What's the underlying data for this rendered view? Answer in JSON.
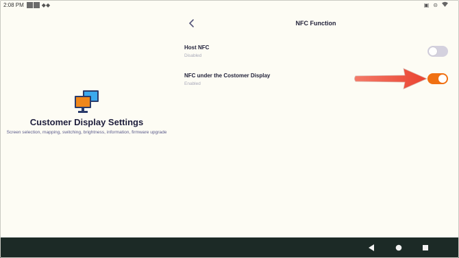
{
  "status_bar": {
    "time": "2:08 PM",
    "notification_icons": [
      "square-icon",
      "square-icon",
      "diamond-icon"
    ],
    "system_icons": [
      "cast-icon",
      "do-not-disturb-icon",
      "wifi-icon"
    ]
  },
  "left_panel": {
    "icon": "monitor-icon",
    "title": "Customer Display Settings",
    "subtitle": "Screen selection, mapping, switching, brightness, information, firmware upgrade"
  },
  "header": {
    "back_icon": "chevron-left-icon",
    "title": "NFC Function"
  },
  "settings": [
    {
      "label": "Host NFC",
      "status": "Disabled",
      "enabled": false
    },
    {
      "label": "NFC under the Costomer Display",
      "status": "Enabled",
      "enabled": true
    }
  ],
  "annotation": {
    "icon": "red-arrow-icon",
    "color": "#ee4e3a"
  },
  "nav_bar": {
    "buttons": [
      "back-triangle-icon",
      "home-circle-icon",
      "recents-square-icon"
    ]
  },
  "colors": {
    "background": "#fdfcf4",
    "accent": "#f07012",
    "toggle_off": "#d4d1de",
    "nav_bar": "#1c2a26"
  }
}
